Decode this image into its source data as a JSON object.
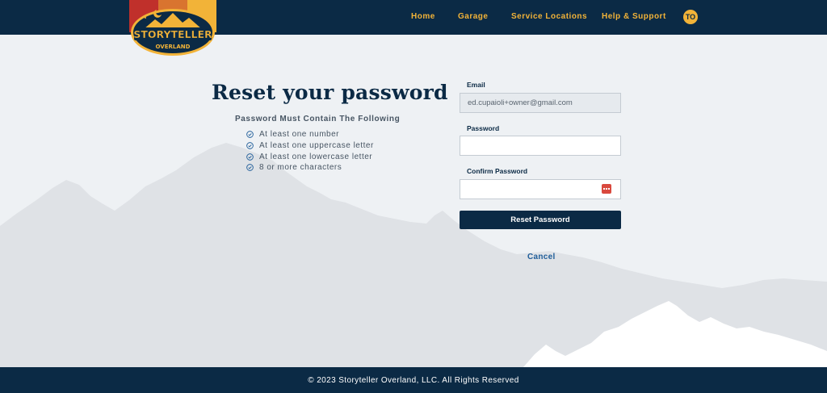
{
  "brand": {
    "logo_text_top": "STORYTELLER",
    "logo_text_bottom": "OVERLAND"
  },
  "nav": {
    "items": [
      {
        "label": "Home"
      },
      {
        "label": "Garage"
      },
      {
        "label": "Service Locations"
      },
      {
        "label": "Help & Support"
      }
    ],
    "avatar_initials": "TO"
  },
  "main": {
    "title": "Reset your password",
    "requirements_title": "Password Must Contain The Following",
    "requirements": [
      "At least one number",
      "At least one uppercase letter",
      "At least one lowercase letter",
      "8 or more characters"
    ]
  },
  "form": {
    "email_label": "Email",
    "email_value": "ed.cupaioli+owner@gmail.com",
    "password_label": "Password",
    "password_value": "",
    "confirm_label": "Confirm Password",
    "confirm_value": "",
    "password_manager_icon": "password-manager-icon",
    "submit_label": "Reset Password",
    "cancel_label": "Cancel"
  },
  "footer": {
    "copyright": "© 2023 Storyteller Overland, LLC. All Rights Reserved"
  },
  "colors": {
    "navy": "#0b2a45",
    "gold": "#f2b338",
    "red": "#c0302b",
    "orange": "#d9742f",
    "link": "#1f5d99",
    "background": "#eef1f4"
  }
}
